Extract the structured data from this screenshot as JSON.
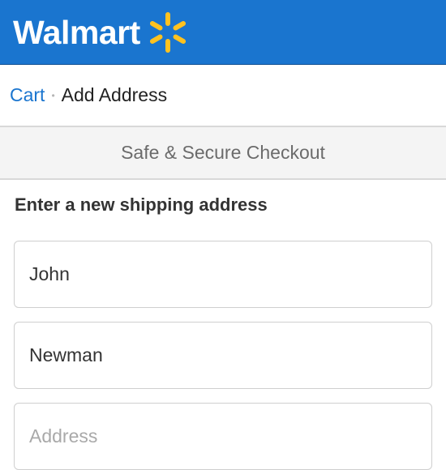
{
  "header": {
    "logo_text": "Walmart",
    "brand_color": "#1a75cf",
    "spark_color": "#ffc220",
    "spark_icon": "walmart-spark-icon"
  },
  "breadcrumb": {
    "link_label": "Cart",
    "separator": "•",
    "current_label": "Add Address"
  },
  "secure_banner": {
    "text": "Safe & Secure Checkout"
  },
  "form": {
    "title": "Enter a new shipping address",
    "first_name": {
      "value": "John"
    },
    "last_name": {
      "value": "Newman"
    },
    "address": {
      "value": "",
      "placeholder": "Address"
    }
  }
}
